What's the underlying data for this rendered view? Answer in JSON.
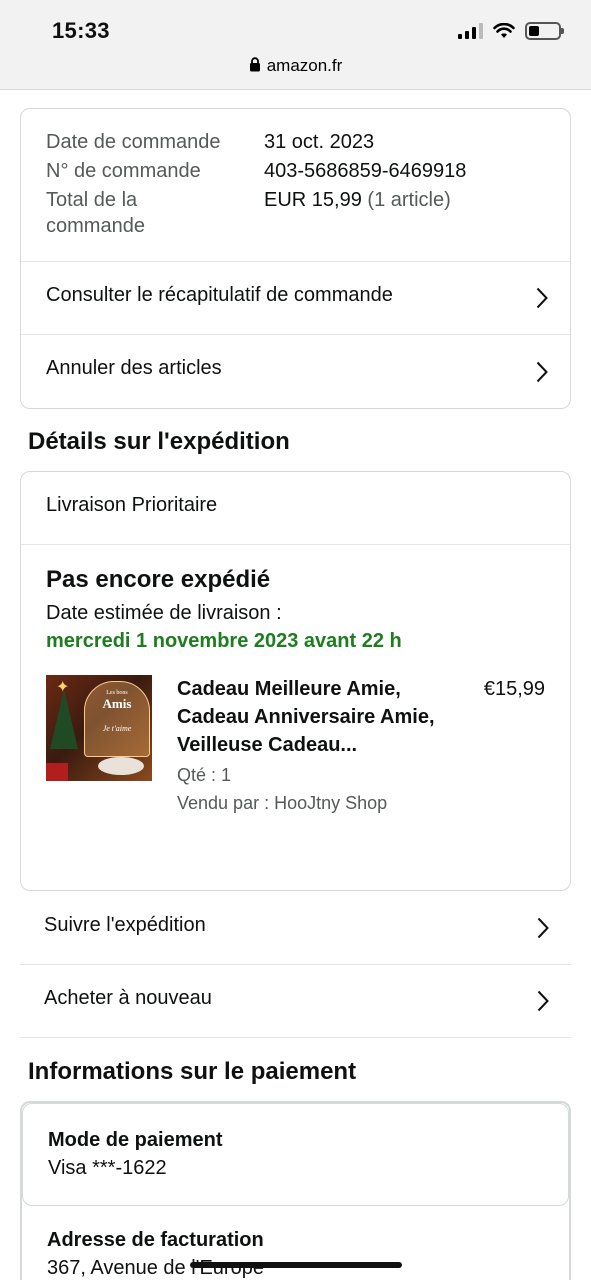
{
  "status_bar": {
    "time": "15:33",
    "url": "amazon.fr",
    "battery_level": 0.35
  },
  "order_summary": {
    "date_label": "Date de commande",
    "date_value": "31 oct. 2023",
    "number_label": "N° de commande",
    "number_value": "403-5686859-6469918",
    "total_label": "Total de la commande",
    "total_value": "EUR 15,99",
    "total_items": "(1 article)",
    "view_summary": "Consulter le récapitulatif de commande",
    "cancel_items": "Annuler des articles"
  },
  "shipping": {
    "title": "Détails sur l'expédition",
    "delivery_type": "Livraison Prioritaire",
    "status": "Pas encore expédié",
    "estimated_label": "Date estimée de livraison :",
    "estimated_date": "mercredi 1 novembre 2023 avant 22 h",
    "product": {
      "title": "Cadeau Meilleure Amie, Cadeau Anniversaire Amie, Veilleuse Cadeau...",
      "price": "€15,99",
      "quantity": "Qté : 1",
      "seller": "Vendu par : HooJtny Shop",
      "image_text_1": "Les bons",
      "image_text_2": "Amis",
      "image_text_3": "Je t'aime"
    },
    "track": "Suivre l'expédition",
    "buy_again": "Acheter à nouveau"
  },
  "payment": {
    "title": "Informations sur le paiement",
    "method_label": "Mode de paiement",
    "method_value": "Visa ***-1622",
    "billing_label": "Adresse de facturation",
    "billing_value": "367, Avenue de l'Europe"
  },
  "icons": {
    "lock": "lock-icon",
    "chevron": "chevron-right-icon",
    "wifi": "wifi-icon",
    "signal": "signal-icon",
    "battery": "battery-icon"
  }
}
